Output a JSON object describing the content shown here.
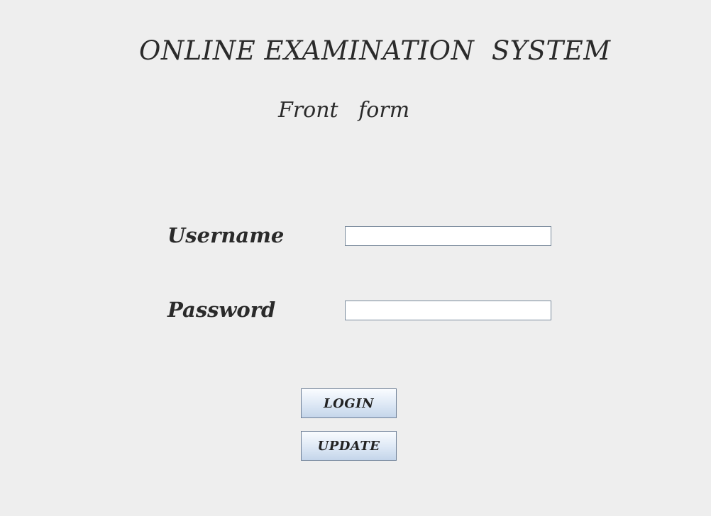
{
  "header": {
    "title": "ONLINE EXAMINATION  SYSTEM",
    "subtitle": "Front   form"
  },
  "form": {
    "username_label": "Username",
    "password_label": "Password",
    "username_value": "",
    "password_value": ""
  },
  "buttons": {
    "login_label": "LOGIN",
    "update_label": "UPDATE"
  }
}
